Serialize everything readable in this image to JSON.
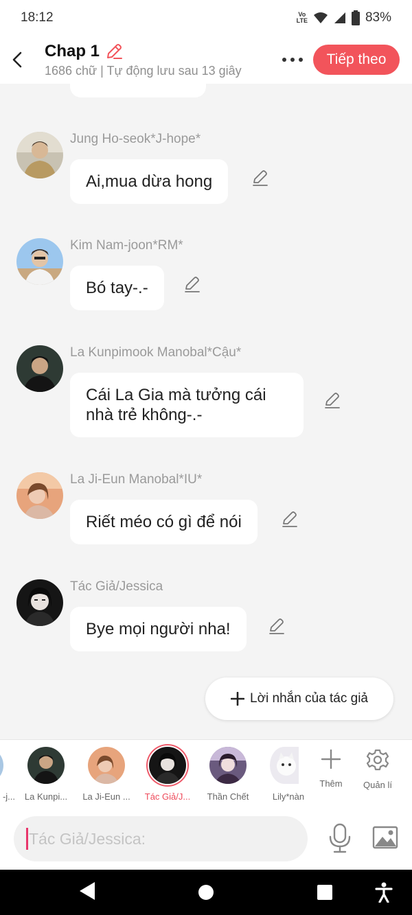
{
  "status_bar": {
    "time": "18:12",
    "network": "VoLTE",
    "battery": "83%"
  },
  "header": {
    "title": "Chap 1",
    "subtitle": "1686 chữ | Tự động lưu sau 13 giây",
    "next_label": "Tiếp theo"
  },
  "messages": [
    {
      "sender": "Jung Ho-seok*J-hope*",
      "text": "Ai,mua dừa hong"
    },
    {
      "sender": "Kim Nam-joon*RM*",
      "text": "Bó tay-.-"
    },
    {
      "sender": "La Kunpimook Manobal*Cậu*",
      "text": "Cái La Gia mà tưởng cái nhà trẻ không-.-"
    },
    {
      "sender": "La Ji-Eun Manobal*IU*",
      "text": "Riết méo có gì để nói"
    },
    {
      "sender": "Tác Giả/Jessica",
      "text": "Bye mọi người nha!"
    }
  ],
  "author_message_button": "Lời nhắn của tác giả",
  "characters": [
    {
      "name": "-j..."
    },
    {
      "name": "La Kunpi..."
    },
    {
      "name": "La Ji-Eun ..."
    },
    {
      "name": "Tác Giả/J...",
      "selected": true
    },
    {
      "name": "Thần Chết"
    },
    {
      "name": "Lily*nàn"
    }
  ],
  "tools": {
    "add_label": "Thêm",
    "manage_label": "Quản lí"
  },
  "input": {
    "placeholder": "Tác Giả/Jessica:"
  },
  "colors": {
    "accent": "#f2545b",
    "selected": "#ee4a5a",
    "caret": "#e8356b"
  }
}
